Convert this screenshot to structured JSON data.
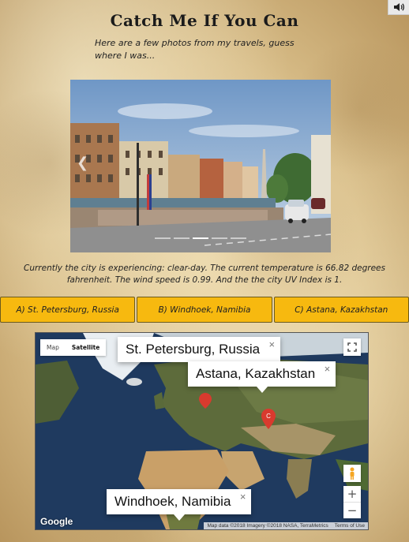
{
  "page": {
    "title": "Catch Me If You Can",
    "intro": "Here are a few photos from my travels, guess where I was..."
  },
  "carousel": {
    "prev_icon": "chevron-left-icon",
    "slide_count": 5,
    "active_slide": 3
  },
  "weather_text": "Currently the city is experiencing: clear-day. The current temperature is 66.82 degrees fahrenheit. The wind speed is 0.99. And the the city UV Index is 1.",
  "answers": [
    "A) St. Petersburg, Russia",
    "B) Windhoek, Namibia",
    "C) Astana, Kazakhstan"
  ],
  "map": {
    "type_buttons": [
      "Map",
      "Satellite"
    ],
    "selected_type": "Satellite",
    "info_windows": {
      "st_petersburg": "St. Petersburg, Russia",
      "astana": "Astana, Kazakhstan",
      "windhoek": "Windhoek, Namibia"
    },
    "marker_c_label": "C",
    "close_glyph": "×",
    "zoom_in": "+",
    "zoom_out": "−",
    "logo": "Google",
    "attribution": "Map data ©2018 Imagery ©2018 NASA, TerraMetrics",
    "terms": "Terms of Use"
  },
  "colors": {
    "answer_bg": "#f7b90f",
    "marker": "#d93a2e"
  }
}
